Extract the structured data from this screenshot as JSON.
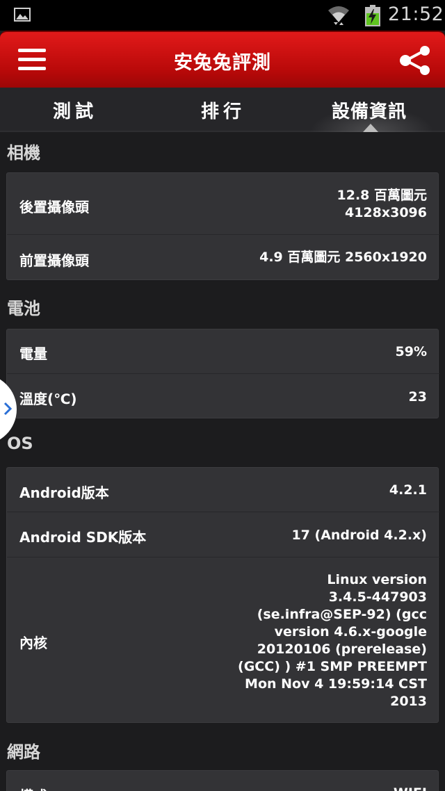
{
  "status_bar": {
    "time": "21:52",
    "icons": [
      "gallery-icon",
      "wifi-icon",
      "battery-charging-icon"
    ]
  },
  "app_bar": {
    "title": "安兔兔評測",
    "menu_icon": "menu-icon",
    "share_icon": "share-icon",
    "color": "#c80e0e"
  },
  "tabs": [
    {
      "label": "測試"
    },
    {
      "label": "排行"
    },
    {
      "label": "設備資訊",
      "selected": true
    }
  ],
  "sections": {
    "camera": {
      "title": "相機",
      "rows": [
        {
          "label": "後置攝像頭",
          "value": "12.8 百萬圖元\n4128x3096"
        },
        {
          "label": "前置攝像頭",
          "value": "4.9 百萬圖元   2560x1920"
        }
      ]
    },
    "battery": {
      "title": "電池",
      "rows": [
        {
          "label": "電量",
          "value": "59%"
        },
        {
          "label": "溫度(℃)",
          "value": "23"
        }
      ]
    },
    "os": {
      "title": "OS",
      "rows": [
        {
          "label": "Android版本",
          "value": "4.2.1"
        },
        {
          "label": "Android SDK版本",
          "value": "17  (Android 4.2.x)"
        },
        {
          "label": "內核",
          "value": "Linux version\n3.4.5-447903\n(se.infra@SEP-92) (gcc\nversion 4.6.x-google\n20120106 (prerelease)\n(GCC) ) #1 SMP PREEMPT\nMon Nov 4 19:59:14 CST\n2013"
        }
      ]
    },
    "network": {
      "title": "網路",
      "rows": [
        {
          "label": "模式",
          "value": "WIFI"
        }
      ]
    }
  },
  "colors": {
    "background": "#1c1c1e",
    "card": "#333336",
    "accent": "#c80e0e"
  }
}
